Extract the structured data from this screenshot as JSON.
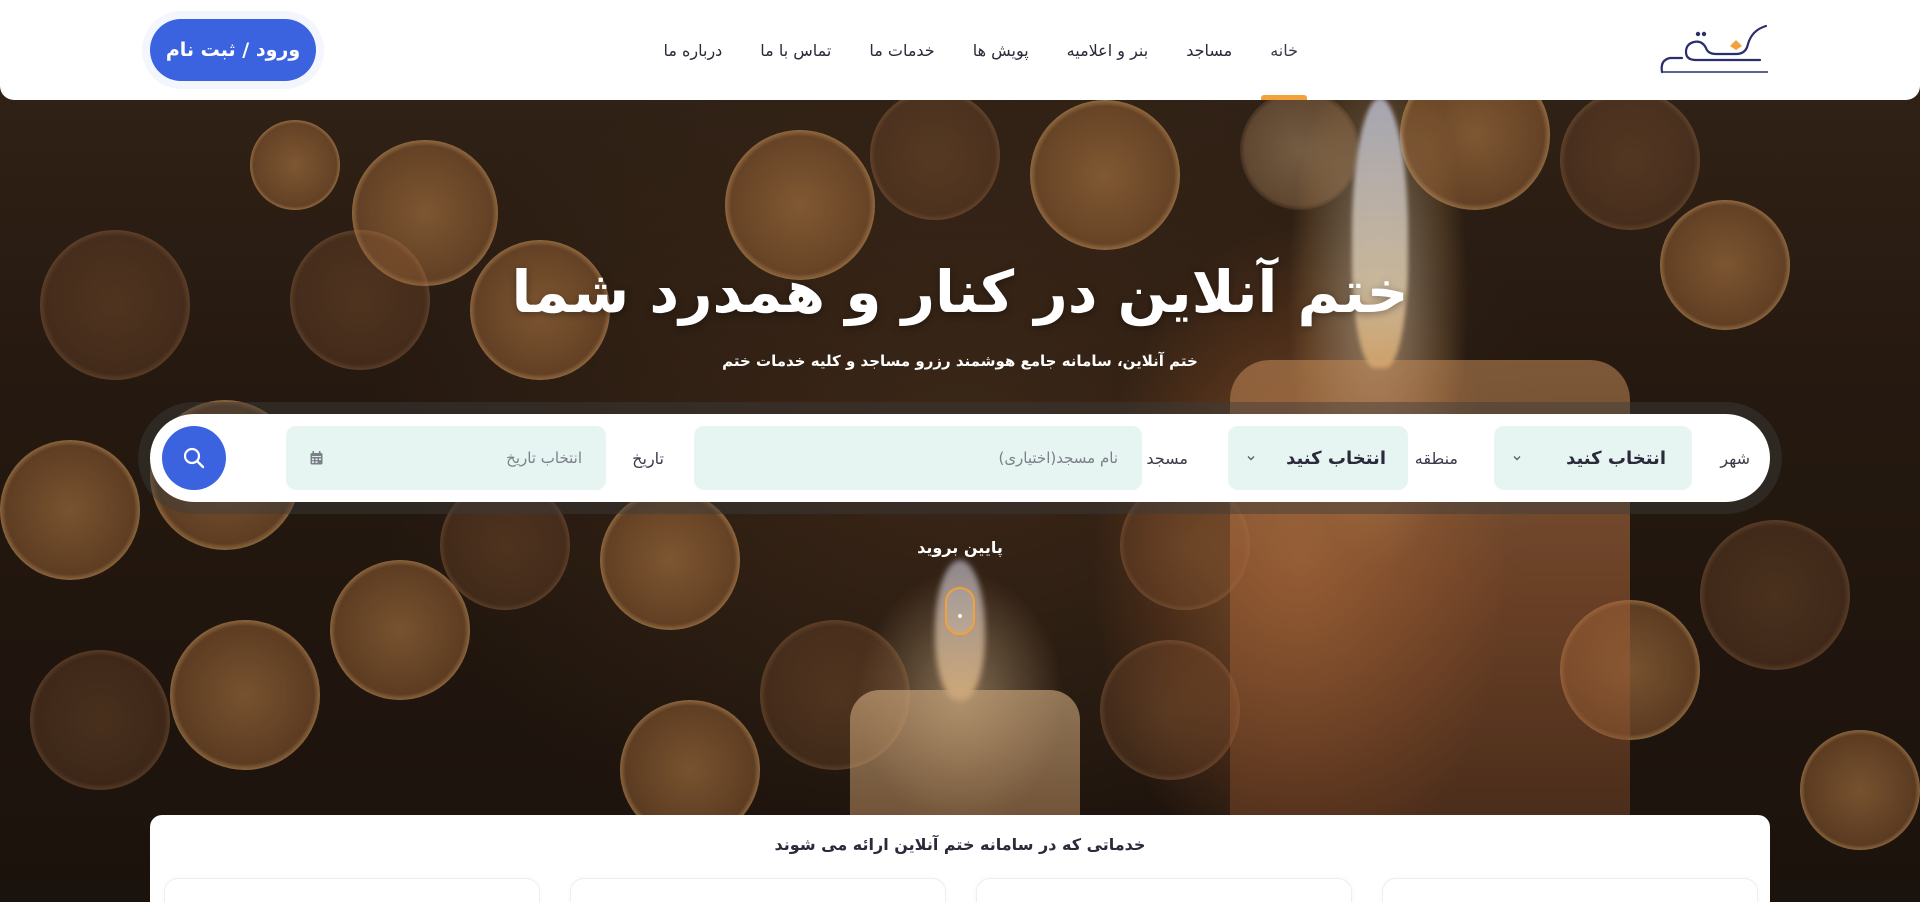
{
  "colors": {
    "accent_blue": "#3b63e0",
    "accent_orange": "#f2a23a",
    "field_bg": "#e6f4f2"
  },
  "header": {
    "logo_icon": "khatm-logo-icon",
    "nav": [
      {
        "label": "خانه",
        "active": true
      },
      {
        "label": "مساجد",
        "active": false
      },
      {
        "label": "بنر و اعلامیه",
        "active": false
      },
      {
        "label": "پویش ها",
        "active": false
      },
      {
        "label": "خدمات ما",
        "active": false
      },
      {
        "label": "تماس با ما",
        "active": false
      },
      {
        "label": "درباره ما",
        "active": false
      }
    ],
    "login_label": "ورود / ثبت نام"
  },
  "hero": {
    "title": "ختم آنلاین در کنار و همدرد شما",
    "subtitle": "ختم آنلاین، سامانه جامع هوشمند رزرو مساجد و کلیه خدمات ختم"
  },
  "search": {
    "city_label": "شهر",
    "city_value": "انتخاب کنید",
    "region_label": "منطقه",
    "region_value": "انتخاب کنید",
    "mosque_label": "مسجد",
    "mosque_placeholder": "نام مسجد(اختیاری)",
    "date_label": "تاریخ",
    "date_placeholder": "انتخاب تاریخ",
    "calendar_icon": "calendar-icon",
    "search_icon": "search-icon"
  },
  "scroll": {
    "label": "پایین بروید"
  },
  "services": {
    "title": "خدماتی که در سامانه ختم آنلاین ارائه می شوند"
  }
}
